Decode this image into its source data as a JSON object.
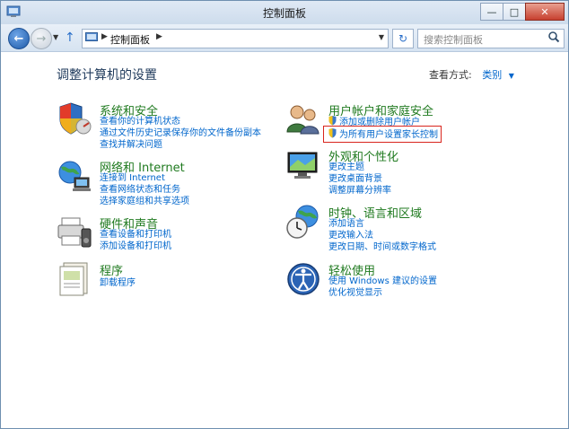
{
  "window": {
    "title": "控制面板"
  },
  "window_buttons": {
    "minimize": "—",
    "maximize": "□",
    "close": "✕"
  },
  "toolbar": {
    "back": "←",
    "forward": "→",
    "up": "↑",
    "refresh": "↻"
  },
  "address": {
    "crumbs": [
      "控制面板"
    ]
  },
  "search": {
    "placeholder": "搜索控制面板"
  },
  "main": {
    "heading": "调整计算机的设置",
    "view_label": "查看方式:",
    "view_value": "类别"
  },
  "categories_left": [
    {
      "title": "系统和安全",
      "links": [
        "查看你的计算机状态",
        "通过文件历史记录保存你的文件备份副本",
        "查找并解决问题"
      ],
      "icon": "system-security-icon"
    },
    {
      "title": "网络和 Internet",
      "links": [
        "连接到 Internet",
        "查看网络状态和任务",
        "选择家庭组和共享选项"
      ],
      "icon": "network-internet-icon"
    },
    {
      "title": "硬件和声音",
      "links": [
        "查看设备和打印机",
        "添加设备和打印机"
      ],
      "icon": "hardware-sound-icon"
    },
    {
      "title": "程序",
      "links": [
        "卸载程序"
      ],
      "icon": "programs-icon"
    }
  ],
  "categories_right": [
    {
      "title": "用户帐户和家庭安全",
      "links": [
        "添加或删除用户帐户",
        "为所有用户设置家长控制"
      ],
      "icon": "user-accounts-icon"
    },
    {
      "title": "外观和个性化",
      "links": [
        "更改主题",
        "更改桌面背景",
        "调整屏幕分辨率"
      ],
      "icon": "appearance-icon"
    },
    {
      "title": "时钟、语言和区域",
      "links": [
        "添加语言",
        "更改输入法",
        "更改日期、时间或数字格式"
      ],
      "icon": "clock-language-icon"
    },
    {
      "title": "轻松使用",
      "links": [
        "使用 Windows 建议的设置",
        "优化视觉显示"
      ],
      "icon": "ease-of-access-icon"
    }
  ],
  "colors": {
    "category_title": "#1f7a1f",
    "link": "#0066cc",
    "highlight_border": "#d9251d"
  }
}
